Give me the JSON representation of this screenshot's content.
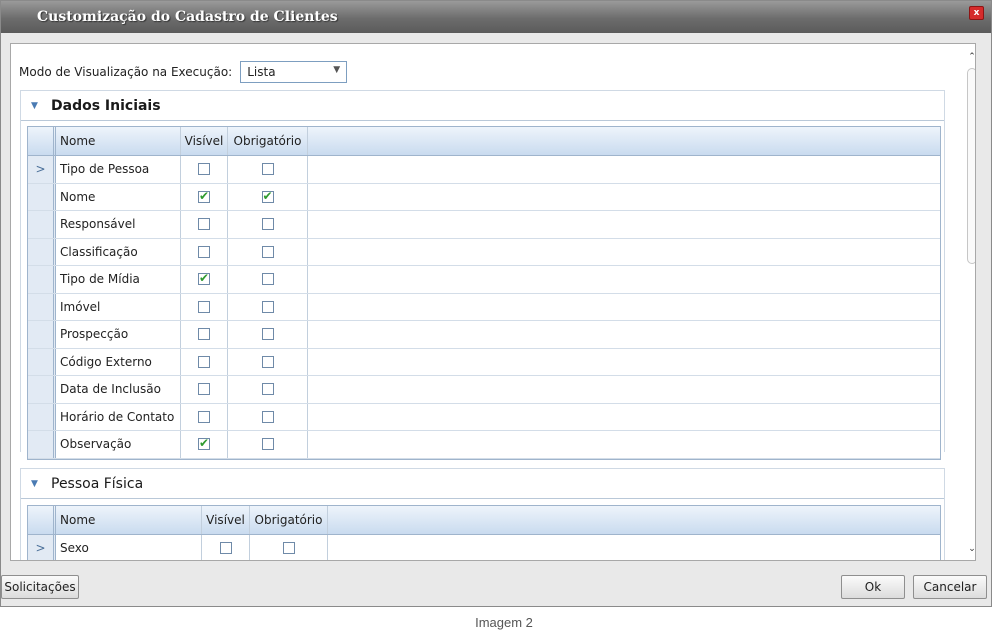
{
  "window": {
    "title": "Customização do Cadastro de Clientes",
    "close_label": "x"
  },
  "mode": {
    "label": "Modo de Visualização na Execução:",
    "value": "Lista"
  },
  "sections": [
    {
      "title": "Dados Iniciais",
      "columns": {
        "name": "Nome",
        "visible": "Visível",
        "required": "Obrigatório"
      },
      "rows": [
        {
          "name": "Tipo de Pessoa",
          "visible": false,
          "required": false,
          "current": true
        },
        {
          "name": "Nome",
          "visible": true,
          "required": true
        },
        {
          "name": "Responsável",
          "visible": false,
          "required": false
        },
        {
          "name": "Classificação",
          "visible": false,
          "required": false
        },
        {
          "name": "Tipo de Mídia",
          "visible": true,
          "required": false
        },
        {
          "name": "Imóvel",
          "visible": false,
          "required": false
        },
        {
          "name": "Prospecção",
          "visible": false,
          "required": false
        },
        {
          "name": "Código Externo",
          "visible": false,
          "required": false
        },
        {
          "name": "Data de Inclusão",
          "visible": false,
          "required": false
        },
        {
          "name": "Horário de Contato",
          "visible": false,
          "required": false
        },
        {
          "name": "Observação",
          "visible": true,
          "required": false
        }
      ]
    },
    {
      "title": "Pessoa Física",
      "columns": {
        "name": "Nome",
        "visible": "Visível",
        "required": "Obrigatório"
      },
      "rows": [
        {
          "name": "Sexo",
          "visible": false,
          "required": false,
          "current": true
        }
      ]
    }
  ],
  "row_marker": ">",
  "buttons": {
    "requests": "Solicitações",
    "ok": "Ok",
    "cancel": "Cancelar"
  },
  "caption": "Imagem 2",
  "icons": {
    "section_toggle": "triangle-down-icon",
    "select_arrow": "chevron-down-icon",
    "scroll_up": "chevron-up-icon",
    "scroll_down": "chevron-down-icon"
  }
}
